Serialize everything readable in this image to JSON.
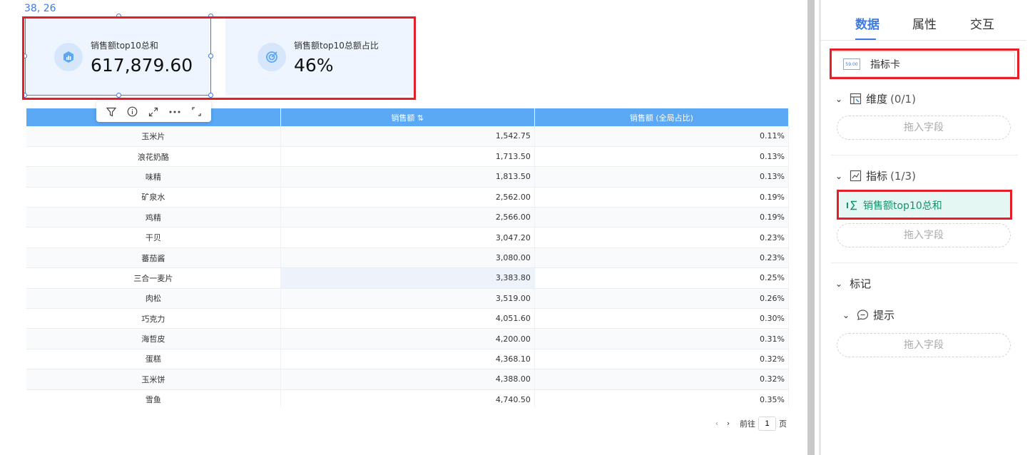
{
  "canvas": {
    "coordinates": "38, 26",
    "kpi_cards": [
      {
        "label": "销售额top10总和",
        "value": "617,879.60"
      },
      {
        "label": "销售额top10总额占比",
        "value": "46%"
      }
    ]
  },
  "table": {
    "headers": [
      "",
      "销售额 ⇅",
      "销售额 (全局占比)"
    ],
    "rows": [
      [
        "玉米片",
        "1,542.75",
        "0.11%"
      ],
      [
        "浪花奶酪",
        "1,713.50",
        "0.13%"
      ],
      [
        "味精",
        "1,813.50",
        "0.13%"
      ],
      [
        "矿泉水",
        "2,562.00",
        "0.19%"
      ],
      [
        "鸡精",
        "2,566.00",
        "0.19%"
      ],
      [
        "干贝",
        "3,047.20",
        "0.23%"
      ],
      [
        "蕃茄酱",
        "3,080.00",
        "0.23%"
      ],
      [
        "三合一麦片",
        "3,383.80",
        "0.25%"
      ],
      [
        "肉松",
        "3,519.00",
        "0.26%"
      ],
      [
        "巧克力",
        "4,051.60",
        "0.30%"
      ],
      [
        "海哲皮",
        "4,200.00",
        "0.31%"
      ],
      [
        "蛋糕",
        "4,368.10",
        "0.32%"
      ],
      [
        "玉米饼",
        "4,388.00",
        "0.32%"
      ],
      [
        "雪鱼",
        "4,740.50",
        "0.35%"
      ]
    ]
  },
  "pager": {
    "goto_label": "前往",
    "page_value": "1",
    "page_suffix": "页"
  },
  "panel": {
    "tabs": [
      "数据",
      "属性",
      "交互"
    ],
    "active_tab": "数据",
    "chart_type": {
      "icon_text": "59.00",
      "label": "指标卡"
    },
    "dimension": {
      "label": "维度",
      "count": "(0/1)",
      "drop_placeholder": "拖入字段"
    },
    "measure": {
      "label": "指标",
      "count": "(1/3)",
      "field": "销售额top10总和",
      "drop_placeholder": "拖入字段"
    },
    "mark": {
      "label": "标记"
    },
    "tooltip": {
      "label": "提示",
      "drop_placeholder": "拖入字段"
    }
  },
  "colors": {
    "accent": "#3f7ae0",
    "header": "#5ba8f5",
    "highlight": "#e3202a",
    "field_green": "#12936c"
  }
}
